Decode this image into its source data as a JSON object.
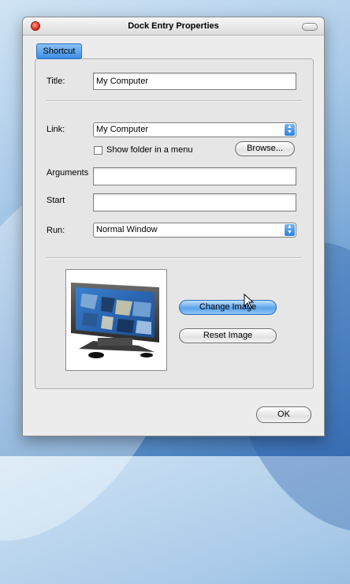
{
  "window": {
    "title": "Dock Entry Properties"
  },
  "tabs": [
    {
      "label": "Shortcut"
    }
  ],
  "form": {
    "title_label": "Title:",
    "title_value": "My Computer",
    "link_label": "Link:",
    "link_value": "My Computer",
    "show_folder_label": "Show folder in a menu",
    "show_folder_checked": false,
    "browse_label": "Browse...",
    "arguments_label": "Arguments",
    "arguments_value": "",
    "start_label": "Start",
    "start_value": "",
    "run_label": "Run:",
    "run_value": "Normal Window"
  },
  "image": {
    "icon_name": "monitor-icon",
    "change_label": "Change Image",
    "reset_label": "Reset Image"
  },
  "footer": {
    "ok_label": "OK"
  },
  "colors": {
    "accent": "#3b8ee6",
    "close": "#e23c2c"
  }
}
